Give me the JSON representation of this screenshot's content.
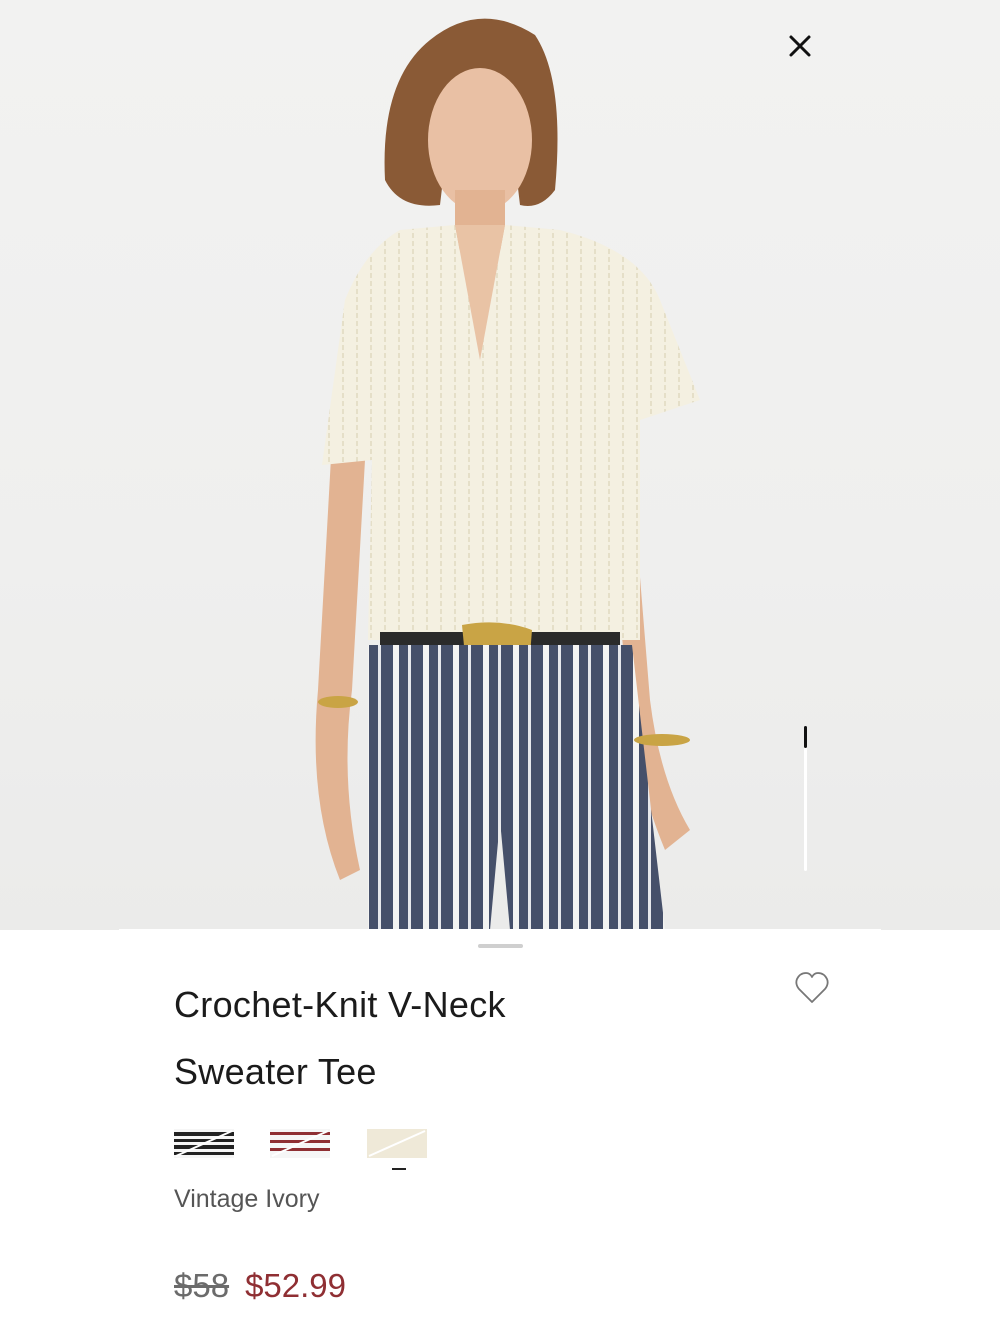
{
  "product": {
    "title_line1": "Crochet-Knit V-Neck",
    "title_line2": "Sweater Tee",
    "color_name": "Vintage Ivory",
    "price_original": "$58",
    "price_sale": "$52.99"
  },
  "colors": {
    "sale": "#8f2f33",
    "text": "#1b1b1b",
    "muted": "#555555"
  },
  "swatches": [
    {
      "name": "black-stripe",
      "color": "#222222",
      "selected": false
    },
    {
      "name": "red-stripe",
      "color": "#8f2f33",
      "selected": false
    },
    {
      "name": "ivory",
      "color": "#efe9d8",
      "selected": true
    }
  ],
  "icons": {
    "close": "close-icon",
    "favorite": "heart-outline-icon"
  },
  "image_carousel": {
    "position": 1
  }
}
